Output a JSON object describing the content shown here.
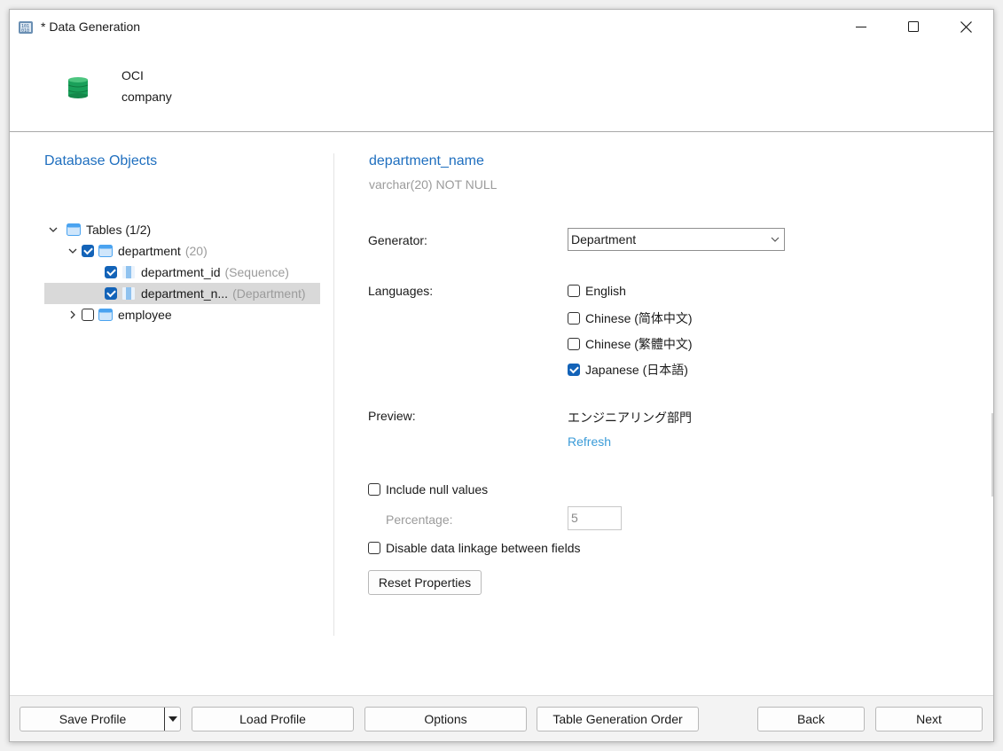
{
  "window": {
    "title": "* Data Generation",
    "controls": [
      "minimize-icon",
      "maximize-icon",
      "close-icon"
    ]
  },
  "connection": {
    "icon": "database-icon",
    "name": "OCI",
    "database": "company"
  },
  "left_panel": {
    "title": "Database Objects",
    "tree": {
      "root": {
        "label": "Tables (1/2)",
        "expanded": true
      },
      "tables": [
        {
          "name": "department",
          "count": "(20)",
          "checked": true,
          "expanded": true,
          "columns": [
            {
              "name": "department_id",
              "generator": "(Sequence)",
              "checked": true,
              "selected": false
            },
            {
              "name": "department_n...",
              "generator": "(Department)",
              "checked": true,
              "selected": true
            }
          ]
        },
        {
          "name": "employee",
          "checked": false,
          "expanded": false
        }
      ]
    }
  },
  "detail": {
    "field_name": "department_name",
    "field_type": "varchar(20) NOT NULL",
    "generator_label": "Generator:",
    "generator_value": "Department",
    "languages_label": "Languages:",
    "languages": [
      {
        "label": "English",
        "checked": false
      },
      {
        "label": "Chinese (简体中文)",
        "checked": false
      },
      {
        "label": "Chinese (繁體中文)",
        "checked": false
      },
      {
        "label": "Japanese (日本語)",
        "checked": true
      }
    ],
    "preview_label": "Preview:",
    "preview_value": "エンジニアリング部門",
    "refresh_link": "Refresh",
    "include_null_label": "Include null values",
    "include_null_checked": false,
    "percentage_label": "Percentage:",
    "percentage_value": "5",
    "disable_linkage_label": "Disable data linkage between fields",
    "disable_linkage_checked": false,
    "reset_button": "Reset Properties"
  },
  "footer": {
    "save_profile": "Save Profile",
    "load_profile": "Load Profile",
    "options": "Options",
    "table_generation_order": "Table Generation Order",
    "back": "Back",
    "next": "Next"
  },
  "colors": {
    "accent_title": "#1f6fbf",
    "link": "#3a9bd8",
    "checkbox_checked": "#1363b8",
    "db_icon": "#1aa05a",
    "table_icon": "#4aa3f0"
  }
}
